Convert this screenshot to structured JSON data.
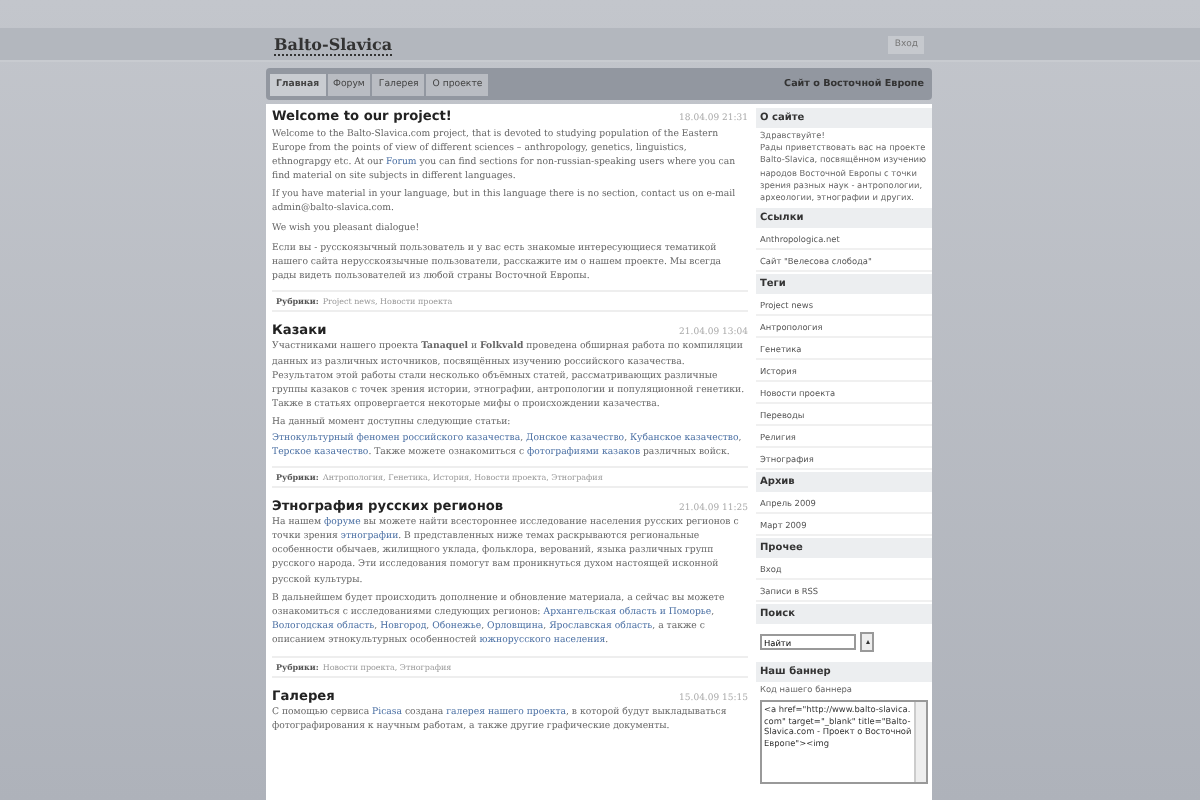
{
  "header": {
    "logo": "Balto-Slavica",
    "login_button": "Вход"
  },
  "nav": {
    "tabs": [
      {
        "label": "Главная",
        "selected": true
      },
      {
        "label": "Форум",
        "selected": false
      },
      {
        "label": "Галерея",
        "selected": false
      },
      {
        "label": "О проекте",
        "selected": false
      }
    ],
    "tagline": "Сайт о Восточной Европе"
  },
  "posts": [
    {
      "title": "Welcome to our project!",
      "date": "18.04.09 21:31",
      "paragraphs": [
        [
          {
            "text": "Welcome to the Balto-Slavica.com project, that is devoted to studying population of the Eastern Europe from the points of view of different sciences – anthropology, genetics, linguistics, ethnograpgy etc. At our ",
            "link": false
          },
          {
            "text": "Forum",
            "link": true
          },
          {
            "text": " you can find sections for non-russian-speaking users where you can find material on site subjects in different languages.",
            "link": false
          }
        ],
        [
          {
            "text": "If you have material in your language, but in this language there is no section, contact us on e-mail admin@balto-slavica.com.",
            "link": false
          }
        ],
        [
          {
            "text": "We wish you pleasant dialogue!",
            "link": false
          }
        ],
        [
          {
            "text": "Если вы - русскоязычный пользователь и у вас есть знакомые интересующиеся тематикой нашего сайта нерусскоязычные пользователи, расскажите им о нашем проекте. Мы всегда рады видеть пользователей из любой страны Восточной Европы.",
            "link": false
          }
        ]
      ],
      "rubrics_label": "Рубрики:",
      "rubrics": "Project news, Новости проекта"
    },
    {
      "title": "Казаки",
      "date": "21.04.09 13:04",
      "paragraphs": [
        [
          {
            "text": "Участниками нашего проекта **Tanaquel** и **Folkvald** проведена обширная работа по компиляции данных из различных источников, посвящённых изучению российского казачества. Результатом этой работы стали несколько объёмных статей, рассматривающих различные группы казаков с точек зрения истории, этнографии, антропологии и популяционной генетики. Также в статьях опровергается некоторые мифы о происхождении казачества.",
            "link": false
          }
        ],
        [
          {
            "text": "На данный момент доступны следующие статьи: ",
            "link": false
          },
          {
            "text": "Этнокультурный феномен российского казачества",
            "link": true
          },
          {
            "text": ", ",
            "link": false
          },
          {
            "text": "Донское казачество",
            "link": true
          },
          {
            "text": ", ",
            "link": false
          },
          {
            "text": "Кубанское казачество",
            "link": true
          },
          {
            "text": ", ",
            "link": false
          },
          {
            "text": "Терское казачество",
            "link": true
          },
          {
            "text": ". Также можете ознакомиться с ",
            "link": false
          },
          {
            "text": "фотографиями казаков",
            "link": true
          },
          {
            "text": " различных войск.",
            "link": false
          }
        ]
      ],
      "rubrics_label": "Рубрики:",
      "rubrics": "Антропология, Генетика, История, Новости проекта, Этнография"
    },
    {
      "title": "Этнография русских регионов",
      "date": "21.04.09 11:25",
      "paragraphs": [
        [
          {
            "text": "На нашем ",
            "link": false
          },
          {
            "text": "форуме",
            "link": true
          },
          {
            "text": " вы можете найти всестороннее исследование населения русских регионов с точки зрения ",
            "link": false
          },
          {
            "text": "этнографии",
            "link": true
          },
          {
            "text": ". В представленных ниже темах раскрываются региональные особенности обычаев, жилищного уклада, фольклора, верований, языка различных групп русского народа. Эти исследования помогут вам проникнуться духом настоящей исконной русской культуры.",
            "link": false
          }
        ],
        [
          {
            "text": "В дальнейшем будет происходить дополнение и обновление материала, а сейчас вы можете ознакомиться с исследованиями следующих регионов: ",
            "link": false
          },
          {
            "text": "Архангельская область и Поморье",
            "link": true
          },
          {
            "text": ", ",
            "link": false
          },
          {
            "text": "Вологодская область",
            "link": true
          },
          {
            "text": ", ",
            "link": false
          },
          {
            "text": "Новгород",
            "link": true
          },
          {
            "text": ", ",
            "link": false
          },
          {
            "text": "Обонежье",
            "link": true
          },
          {
            "text": ", ",
            "link": false
          },
          {
            "text": "Орловщина",
            "link": true
          },
          {
            "text": ", ",
            "link": false
          },
          {
            "text": "Ярославская область",
            "link": true
          },
          {
            "text": ", а также с описанием этнокультурных особенностей ",
            "link": false
          },
          {
            "text": "южнорусского населения",
            "link": true
          },
          {
            "text": ".",
            "link": false
          }
        ]
      ],
      "rubrics_label": "Рубрики:",
      "rubrics": "Новости проекта, Этнография"
    },
    {
      "title": "Галерея",
      "date": "15.04.09 15:15",
      "paragraphs": [
        [
          {
            "text": "С помощью сервиса ",
            "link": false
          },
          {
            "text": "Picasa",
            "link": true
          },
          {
            "text": " создана ",
            "link": false
          },
          {
            "text": "галерея нашего проекта",
            "link": true
          },
          {
            "text": ", в которой будут выкладываться фотографирования к научным работам, а также другие графические документы.",
            "link": false
          }
        ]
      ]
    }
  ],
  "sidebar": [
    {
      "kind": "text",
      "heading": "О сайте",
      "text": "Здравствуйте!\nРады приветствовать вас на проекте Balto-Slavica, посвящённом изучению народов Восточной Европы с точки зрения разных наук - антропологии, археологии, этнографии и других."
    },
    {
      "kind": "links",
      "heading": "Ссылки",
      "items": [
        "Anthropologica.net",
        "Сайт \"Велесова слобода\""
      ]
    },
    {
      "kind": "links",
      "heading": "Теги",
      "items": [
        "Project news",
        "Антропология",
        "Генетика",
        "История",
        "Новости проекта",
        "Переводы",
        "Религия",
        "Этнография"
      ]
    },
    {
      "kind": "links",
      "heading": "Архив",
      "items": [
        "Апрель 2009",
        "Март 2009"
      ]
    },
    {
      "kind": "links",
      "heading": "Прочее",
      "items": [
        "Вход",
        "Записи в RSS"
      ]
    },
    {
      "kind": "search",
      "heading": "Поиск",
      "value": "Найти"
    },
    {
      "kind": "code",
      "heading": "Наш баннер",
      "text": "Код нашего баннера",
      "code": "<a href=\"http://www.balto-slavica.com\" target=\"_blank\" title=\"Balto-Slavica.com - Проект о Восточной Европе\"><img"
    }
  ]
}
